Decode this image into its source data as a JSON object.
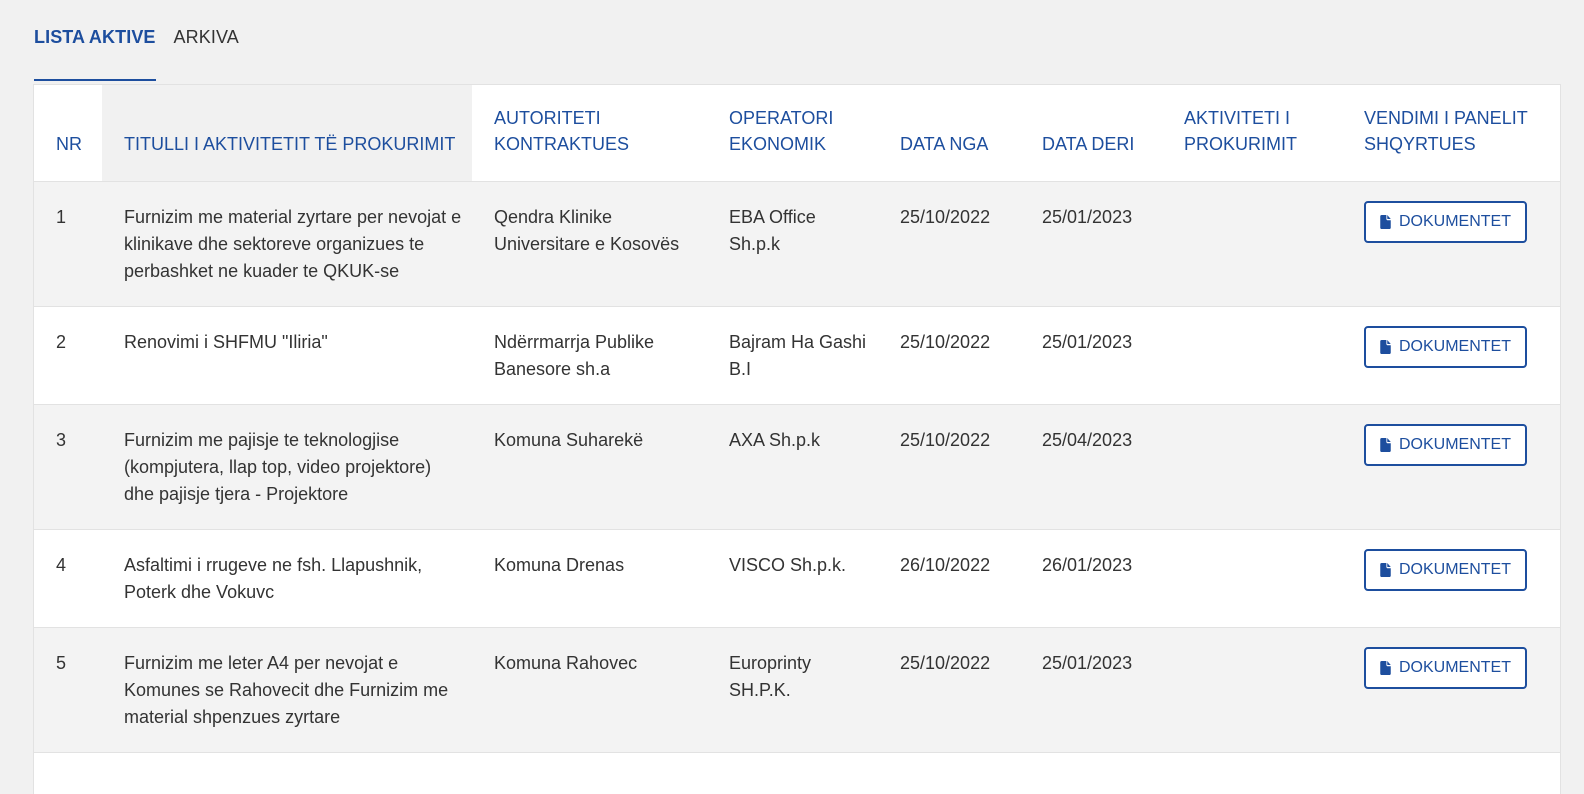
{
  "tabs": [
    {
      "label": "LISTA AKTIVE",
      "active": true
    },
    {
      "label": "ARKIVA",
      "active": false
    }
  ],
  "table": {
    "headers": [
      "NR",
      "TITULLI I AKTIVITETIT TË PROKURIMIT",
      "AUTORITETI KONTRAKTUES",
      "OPERATORI EKONOMIK",
      "DATA NGA",
      "DATA DERI",
      "AKTIVITETI I PROKURIMIT",
      "VENDIMI I PANELIT SHQYRTUES"
    ],
    "rows": [
      {
        "nr": "1",
        "title": "Furnizim me material zyrtare per nevojat e klinikave dhe sektoreve organizues te perbashket ne kuader te QKUK-se",
        "authority": "Qendra Klinike Universitare e Kosovës",
        "operator": "EBA Office Sh.p.k",
        "from": "25/10/2022",
        "to": "25/01/2023",
        "activity": "",
        "doc_label": "DOKUMENTET"
      },
      {
        "nr": "2",
        "title": "Renovimi i SHFMU \"Iliria\"",
        "authority": "Ndërrmarrja Publike Banesore sh.a",
        "operator": "Bajram Ha Gashi B.I",
        "from": "25/10/2022",
        "to": "25/01/2023",
        "activity": "",
        "doc_label": "DOKUMENTET"
      },
      {
        "nr": "3",
        "title": "Furnizim me pajisje te teknologjise (kompjutera, llap top, video projektore) dhe pajisje tjera - Projektore",
        "authority": "Komuna Suharekë",
        "operator": "AXA Sh.p.k",
        "from": "25/10/2022",
        "to": "25/04/2023",
        "activity": "",
        "doc_label": "DOKUMENTET"
      },
      {
        "nr": "4",
        "title": "Asfaltimi i rrugeve ne fsh. Llapushnik, Poterk dhe Vokuvc",
        "authority": "Komuna Drenas",
        "operator": "VISCO Sh.p.k.",
        "from": "26/10/2022",
        "to": "26/01/2023",
        "activity": "",
        "doc_label": "DOKUMENTET"
      },
      {
        "nr": "5",
        "title": "Furnizim me leter A4 per nevojat e Komunes se Rahovecit dhe Furnizim me material shpenzues zyrtare",
        "authority": "Komuna Rahovec",
        "operator": "Europrinty SH.P.K.",
        "from": "25/10/2022",
        "to": "25/01/2023",
        "activity": "",
        "doc_label": "DOKUMENTET"
      }
    ]
  },
  "icons": {
    "document": "file-icon"
  },
  "colors": {
    "accent": "#1d4e9e",
    "row_alt": "#f3f3f3",
    "background": "#f1f1f1"
  }
}
